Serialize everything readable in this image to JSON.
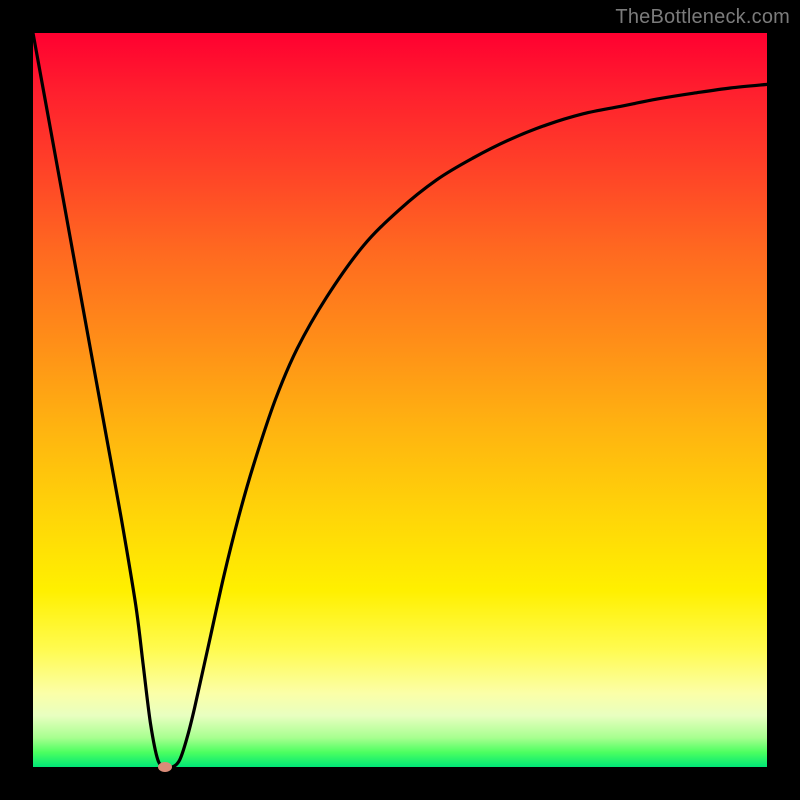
{
  "watermark": "TheBottleneck.com",
  "colors": {
    "frame": "#000000",
    "curve": "#000000",
    "marker": "#d98b78",
    "gradient_stops": [
      "#ff0030",
      "#ff6a20",
      "#ffd608",
      "#fffb50",
      "#00e676"
    ]
  },
  "chart_data": {
    "type": "line",
    "title": "",
    "xlabel": "",
    "ylabel": "",
    "xlim": [
      0,
      100
    ],
    "ylim": [
      0,
      100
    ],
    "x": [
      0,
      2,
      4,
      6,
      8,
      10,
      12,
      14,
      15,
      16,
      17,
      18,
      19,
      20,
      21,
      22,
      24,
      26,
      28,
      30,
      33,
      36,
      40,
      45,
      50,
      55,
      60,
      65,
      70,
      75,
      80,
      85,
      90,
      95,
      100
    ],
    "values": [
      100,
      89,
      78,
      67,
      56,
      45,
      34,
      22,
      14,
      6,
      1,
      0,
      0,
      1,
      4,
      8,
      17,
      26,
      34,
      41,
      50,
      57,
      64,
      71,
      76,
      80,
      83,
      85.5,
      87.5,
      89,
      90,
      91,
      91.8,
      92.5,
      93
    ],
    "marker": {
      "x": 18,
      "y": 0
    },
    "notes": "y-axis is inverted visually (0 at bottom = green, 100 at top = red). Values estimated from gradient-backed curve; no numeric tick labels present in source."
  }
}
